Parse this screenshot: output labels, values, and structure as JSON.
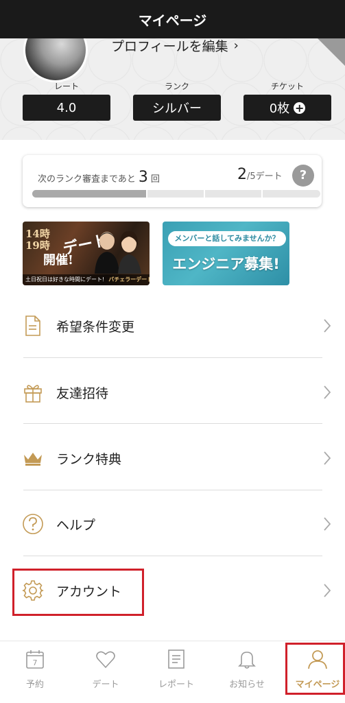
{
  "header": {
    "title": "マイページ"
  },
  "profile": {
    "edit_label": "プロフィールを編集",
    "edit_chevron": "›",
    "stats": [
      {
        "label": "レート",
        "value": "4.0"
      },
      {
        "label": "ランク",
        "value": "シルバー"
      },
      {
        "label": "チケット",
        "value": "0枚",
        "action": "+"
      }
    ]
  },
  "rank_progress": {
    "prefix": "次のランク審査まであと",
    "remaining": "3",
    "remaining_unit": "回",
    "dates_done": "2",
    "dates_total": "/5デート",
    "help": "?",
    "progress": 0.4
  },
  "banners": [
    {
      "lines": [
        "14時",
        "19時"
      ],
      "title": "デート",
      "title2": "開催!",
      "footer": "土日祝日は好きな時間にデート!",
      "brand": "バチェラーデート"
    },
    {
      "pill": "メンバーと話してみませんか？",
      "title": "エンジニア募集!"
    }
  ],
  "menu": [
    {
      "label": "希望条件変更",
      "icon": "document-icon"
    },
    {
      "label": "友達招待",
      "icon": "gift-icon"
    },
    {
      "label": "ランク特典",
      "icon": "crown-icon"
    },
    {
      "label": "ヘルプ",
      "icon": "question-circle-icon"
    },
    {
      "label": "アカウント",
      "icon": "gear-icon"
    }
  ],
  "bottom_nav": [
    {
      "label": "予約",
      "icon": "calendar-icon",
      "badge": "7"
    },
    {
      "label": "デート",
      "icon": "heart-icon"
    },
    {
      "label": "レポート",
      "icon": "report-icon"
    },
    {
      "label": "お知らせ",
      "icon": "bell-icon"
    },
    {
      "label": "マイページ",
      "icon": "person-icon",
      "active": true
    }
  ],
  "colors": {
    "accent": "#c39a55",
    "highlight": "#d0202a",
    "header_bg": "#1a1a1a"
  }
}
